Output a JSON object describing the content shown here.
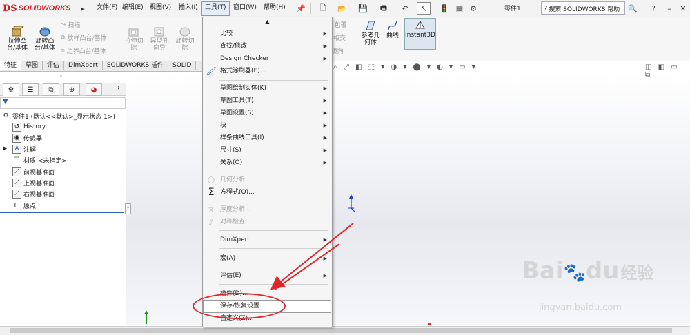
{
  "app": {
    "logo_ds": "DS",
    "logo_text": "SOLIDWORKS",
    "document_name": "零件1",
    "search_placeholder": "搜索 SOLIDWORKS 帮助"
  },
  "menubar": {
    "items": [
      "文件(F)",
      "编辑(E)",
      "视图(V)",
      "插入(I)",
      "工具(T)",
      "窗口(W)",
      "帮助(H)"
    ],
    "active": "工具(T)"
  },
  "commands": {
    "extrude_boss": "拉伸凸\n台/基体",
    "revolve_boss": "旋转凸\n台/基体",
    "sweep": "扫描",
    "loft": "放样凸台/基体",
    "boundary": "边界凸台/基体",
    "extrude_cut": "拉伸切\n除",
    "hole_wizard": "异型孔\n向导",
    "revolve_cut": "旋转切\n除",
    "wrap": "包覆",
    "intersect": "相交",
    "mirror": "镜向",
    "ref_geometry": "参考几\n何体",
    "curves": "曲线",
    "instant3d": "Instant3D"
  },
  "tabs": [
    "特征",
    "草图",
    "评估",
    "DimXpert",
    "SOLIDWORKS 插件",
    "SOLID"
  ],
  "tree": {
    "root": "零件1 (默认<<默认>_显示状态 1>)",
    "items": [
      "History",
      "传感器",
      "注解",
      "材质 <未指定>",
      "前视基准面",
      "上视基准面",
      "右视基准面",
      "原点"
    ]
  },
  "dropdown": {
    "items": [
      {
        "label": "比较",
        "submenu": true
      },
      {
        "label": "查找/修改",
        "submenu": true
      },
      {
        "label": "Design Checker",
        "submenu": true
      },
      {
        "label": "格式涂刷器(E)...",
        "submenu": false
      },
      {
        "label": "草图绘制实体(K)",
        "submenu": true
      },
      {
        "label": "草图工具(T)",
        "submenu": true
      },
      {
        "label": "草图设置(S)",
        "submenu": true
      },
      {
        "label": "块",
        "submenu": true
      },
      {
        "label": "样条曲线工具(I)",
        "submenu": true
      },
      {
        "label": "尺寸(S)",
        "submenu": true
      },
      {
        "label": "关系(O)",
        "submenu": true
      },
      {
        "label": "几何分析...",
        "submenu": false,
        "disabled": true
      },
      {
        "label": "方程式(Q)...",
        "submenu": false
      },
      {
        "label": "厚度分析...",
        "submenu": false,
        "disabled": true
      },
      {
        "label": "对称检查...",
        "submenu": false,
        "disabled": true
      },
      {
        "label": "DimXpert",
        "submenu": true
      },
      {
        "label": "宏(A)",
        "submenu": true
      },
      {
        "label": "评估(E)",
        "submenu": true
      },
      {
        "label": "插件(D)...",
        "submenu": false
      },
      {
        "label": "保存/恢复设置...",
        "submenu": false,
        "highlighted": true
      },
      {
        "label": "自定义(Z)...",
        "submenu": false
      }
    ]
  },
  "watermark": {
    "brand": "Bai",
    "brand2": "du",
    "cn": "经验",
    "url": "jingyan.baidu.com"
  },
  "colors": {
    "accent_red": "#e0262b",
    "logo_red": "#d12128",
    "menu_highlight": "#e4eefa"
  }
}
